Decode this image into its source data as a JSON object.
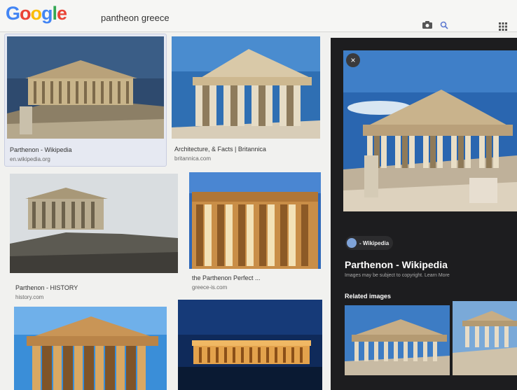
{
  "header": {
    "logo": [
      "G",
      "o",
      "o",
      "g",
      "l",
      "e"
    ],
    "logo_colors": [
      "#4285F4",
      "#EA4335",
      "#FBBC05",
      "#4285F4",
      "#34A853",
      "#EA4335"
    ],
    "search_query": "pantheon greece"
  },
  "results": [
    {
      "title": "Parthenon - Wikipedia",
      "source": "en.wikipedia.org"
    },
    {
      "title": "Architecture, & Facts | Britannica",
      "source": "britannica.com"
    },
    {
      "title": "Parthenon - HISTORY",
      "source": "history.com"
    },
    {
      "title": "the Parthenon Perfect ...",
      "source": "greece-is.com"
    }
  ],
  "preview": {
    "close": "×",
    "source_badge": "- Wikipedia",
    "title": "Parthenon - Wikipedia",
    "note": "Images may be subject to copyright. Learn More",
    "related_heading": "Related images"
  }
}
